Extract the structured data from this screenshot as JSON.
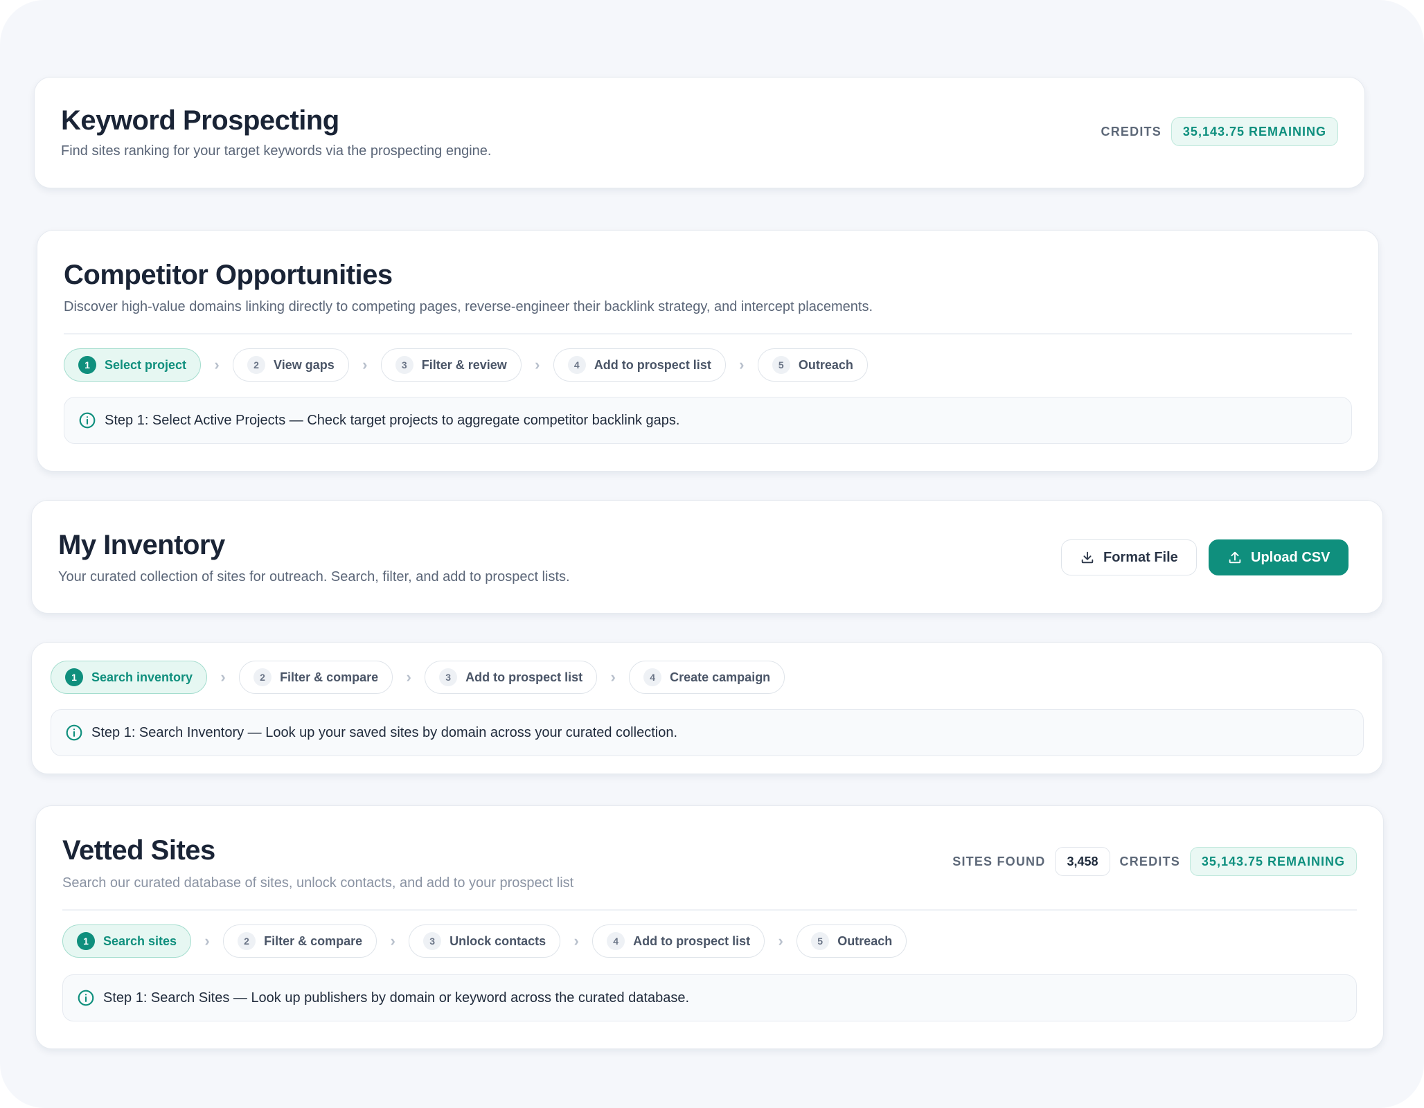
{
  "colors": {
    "accent": "#0f8f7d",
    "accent_light": "#e6f7f2",
    "page_background": "#f5f7fb",
    "card_background": "#ffffff",
    "title_text": "#1a2436",
    "muted_text": "#5b6678"
  },
  "keyword_prospecting": {
    "title": "Keyword Prospecting",
    "subtitle": "Find sites ranking for your target keywords via the prospecting engine.",
    "credits_label": "CREDITS",
    "credits_value": "35,143.75 REMAINING"
  },
  "competitor_opportunities": {
    "title": "Competitor Opportunities",
    "subtitle": "Discover high-value domains linking directly to competing pages, reverse-engineer their backlink strategy, and intercept placements.",
    "steps": [
      {
        "num": "1",
        "label": "Select project",
        "active": true
      },
      {
        "num": "2",
        "label": "View gaps",
        "active": false
      },
      {
        "num": "3",
        "label": "Filter & review",
        "active": false
      },
      {
        "num": "4",
        "label": "Add to prospect list",
        "active": false
      },
      {
        "num": "5",
        "label": "Outreach",
        "active": false
      }
    ],
    "info_icon": "info-circle-icon",
    "info_text": "Step 1: Select Active Projects — Check target projects to aggregate competitor backlink gaps."
  },
  "my_inventory": {
    "title": "My Inventory",
    "subtitle": "Your curated collection of sites for outreach. Search, filter, and add to prospect lists.",
    "format_file_icon": "download-icon",
    "format_file_label": "Format File",
    "upload_icon": "upload-icon",
    "upload_label": "Upload CSV",
    "steps": [
      {
        "num": "1",
        "label": "Search inventory",
        "active": true
      },
      {
        "num": "2",
        "label": "Filter & compare",
        "active": false
      },
      {
        "num": "3",
        "label": "Add to prospect list",
        "active": false
      },
      {
        "num": "4",
        "label": "Create campaign",
        "active": false
      }
    ],
    "info_icon": "info-circle-icon",
    "info_text": "Step 1: Search Inventory — Look up your saved sites by domain across your curated collection."
  },
  "vetted_sites": {
    "title": "Vetted Sites",
    "subtitle": "Search our curated database of sites, unlock contacts, and add to your prospect list",
    "sites_found_label": "SITES FOUND",
    "sites_found_value": "3,458",
    "credits_label": "CREDITS",
    "credits_value": "35,143.75 REMAINING",
    "steps": [
      {
        "num": "1",
        "label": "Search sites",
        "active": true
      },
      {
        "num": "2",
        "label": "Filter & compare",
        "active": false
      },
      {
        "num": "3",
        "label": "Unlock contacts",
        "active": false
      },
      {
        "num": "4",
        "label": "Add to prospect list",
        "active": false
      },
      {
        "num": "5",
        "label": "Outreach",
        "active": false
      }
    ],
    "info_icon": "info-circle-icon",
    "info_text": "Step 1: Search Sites — Look up publishers by domain or keyword across the curated database."
  }
}
